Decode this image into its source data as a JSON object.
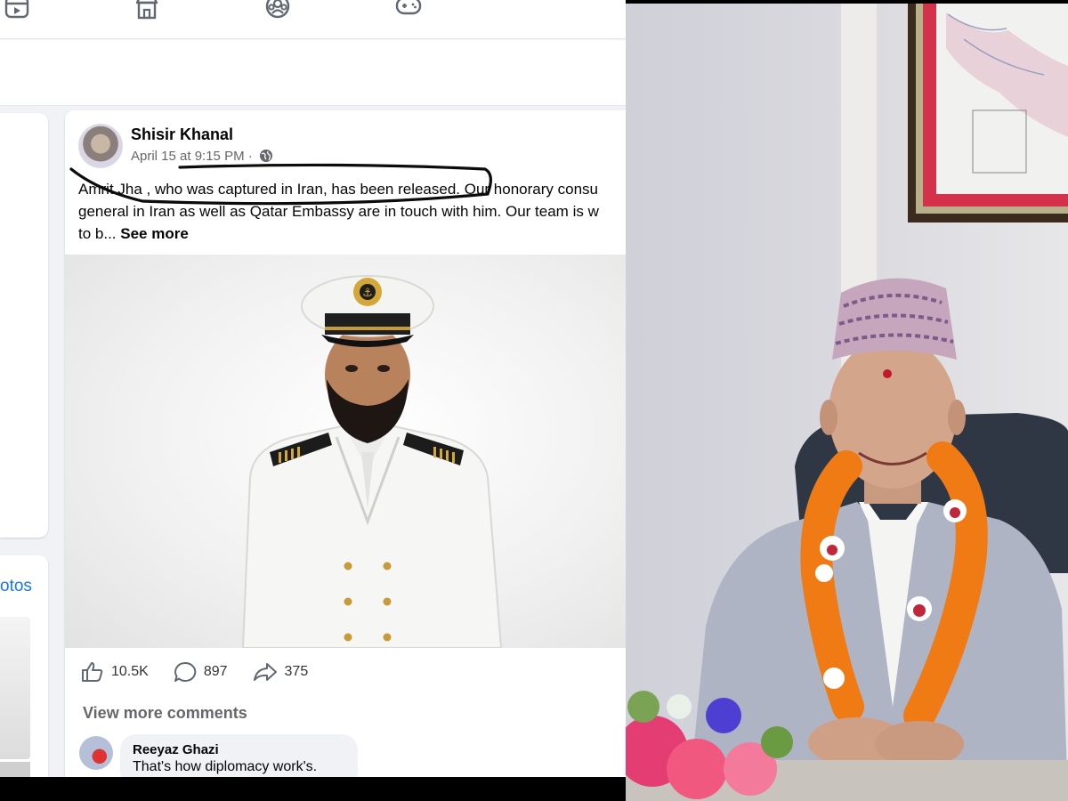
{
  "post": {
    "author": "Shisir Khanal",
    "timestamp": "April 15 at 9:15 PM",
    "separator": "·",
    "text_line1": "Amrit Jha , who was captured in Iran, has been released. Our honorary consu",
    "text_line2": "general in Iran as well as Qatar Embassy are in touch with him. Our team is w",
    "text_line3": "to b...",
    "see_more": "See more",
    "reactions": {
      "likes": "10.5K",
      "comments": "897",
      "shares": "375"
    },
    "view_more_comments": "View more comments",
    "comment": {
      "author": "Reeyaz Ghazi",
      "text": "That's how diplomacy work's."
    }
  },
  "sidebar": {
    "photos_link": "otos"
  },
  "icons": {
    "nav": [
      "video-icon",
      "marketplace-icon",
      "groups-icon",
      "gaming-icon"
    ],
    "privacy": "globe-icon",
    "actions": [
      "like-icon",
      "comment-icon",
      "share-icon"
    ]
  },
  "colors": {
    "link": "#1877f2",
    "secondary_text": "#65676b",
    "page_bg": "#f0f2f5"
  }
}
